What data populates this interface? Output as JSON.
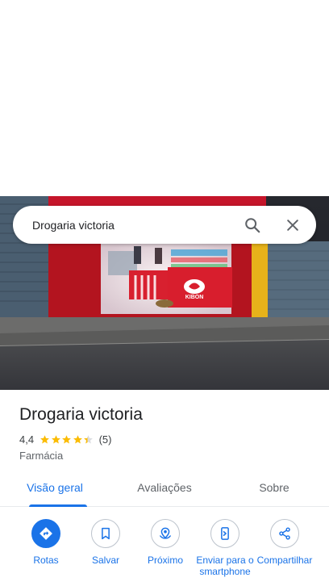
{
  "search": {
    "value": "Drogaria victoria",
    "search_icon": "search-icon",
    "close_icon": "close-icon"
  },
  "hero": {
    "store_sign_text": "KIBON"
  },
  "place": {
    "name": "Drogaria victoria",
    "rating": "4,4",
    "rating_numeric": 4.4,
    "stars_max": 5,
    "review_count": "(5)",
    "category": "Farmácia"
  },
  "tabs": [
    {
      "label": "Visão geral",
      "active": true
    },
    {
      "label": "Avaliações",
      "active": false
    },
    {
      "label": "Sobre",
      "active": false
    }
  ],
  "actions": [
    {
      "label": "Rotas",
      "icon": "directions-icon"
    },
    {
      "label": "Salvar",
      "icon": "bookmark-icon"
    },
    {
      "label": "Próximo",
      "icon": "nearby-icon"
    },
    {
      "label": "Enviar para o smartphone",
      "icon": "send-to-phone-icon"
    },
    {
      "label": "Compartilhar",
      "icon": "share-icon"
    }
  ],
  "colors": {
    "accent": "#1a73e8",
    "star": "#fbbc04",
    "text_primary": "#202124",
    "text_secondary": "#5f6368"
  }
}
